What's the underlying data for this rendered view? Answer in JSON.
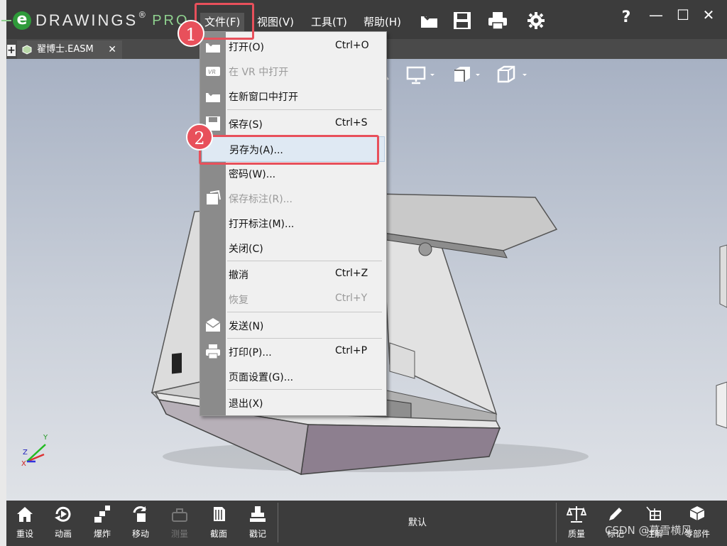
{
  "app": {
    "logo_e": "e",
    "logo_brand": "DRAWINGS",
    "logo_pro": "PRO",
    "registered_mark": "®"
  },
  "menubar": {
    "file": "文件(F)",
    "view": "视图(V)",
    "tools": "工具(T)",
    "help": "帮助(H)"
  },
  "toolbar": {
    "icons": [
      "open-icon",
      "save-icon",
      "print-icon",
      "settings-icon"
    ],
    "help_glyph": "?"
  },
  "window_controls": {
    "minimize": "—",
    "maximize": "☐",
    "close": "✕"
  },
  "tabs": {
    "add": "+",
    "document": {
      "label": "翟博士.EASM",
      "close": "✕"
    }
  },
  "file_menu": {
    "items": [
      {
        "label": "打开(O)",
        "shortcut": "Ctrl+O",
        "enabled": true,
        "icon": "open-icon"
      },
      {
        "label": "在 VR 中打开",
        "shortcut": "",
        "enabled": false,
        "icon": "vr-icon"
      },
      {
        "label": "在新窗口中打开",
        "shortcut": "",
        "enabled": true,
        "icon": "open-new-window-icon"
      },
      {
        "label": "保存(S)",
        "shortcut": "Ctrl+S",
        "enabled": true,
        "icon": "save-icon"
      },
      {
        "label": "另存为(A)...",
        "shortcut": "",
        "enabled": true,
        "icon": ""
      },
      {
        "label": "密码(W)...",
        "shortcut": "",
        "enabled": true,
        "icon": ""
      },
      {
        "label": "保存标注(R)...",
        "shortcut": "",
        "enabled": false,
        "icon": "save-markup-icon"
      },
      {
        "label": "打开标注(M)...",
        "shortcut": "",
        "enabled": true,
        "icon": ""
      },
      {
        "label": "关闭(C)",
        "shortcut": "",
        "enabled": true,
        "icon": ""
      },
      {
        "label": "撤消",
        "shortcut": "Ctrl+Z",
        "enabled": true,
        "icon": ""
      },
      {
        "label": "恢复",
        "shortcut": "Ctrl+Y",
        "enabled": false,
        "icon": ""
      },
      {
        "label": "发送(N)",
        "shortcut": "",
        "enabled": true,
        "icon": "send-icon"
      },
      {
        "label": "打印(P)...",
        "shortcut": "Ctrl+P",
        "enabled": true,
        "icon": "print-icon"
      },
      {
        "label": "页面设置(G)...",
        "shortcut": "",
        "enabled": true,
        "icon": ""
      },
      {
        "label": "退出(X)",
        "shortcut": "",
        "enabled": true,
        "icon": ""
      }
    ]
  },
  "bottom_toolbar": {
    "left": [
      {
        "label": "重设",
        "icon": "home-icon",
        "enabled": true
      },
      {
        "label": "动画",
        "icon": "animate-icon",
        "enabled": true
      },
      {
        "label": "爆炸",
        "icon": "explode-icon",
        "enabled": true
      },
      {
        "label": "移动",
        "icon": "move-icon",
        "enabled": true
      },
      {
        "label": "测量",
        "icon": "measure-icon",
        "enabled": false
      },
      {
        "label": "截面",
        "icon": "section-icon",
        "enabled": true
      },
      {
        "label": "戳记",
        "icon": "stamp-icon",
        "enabled": true
      }
    ],
    "mode": "默认",
    "right": [
      {
        "label": "质量",
        "icon": "scale-icon",
        "enabled": true
      },
      {
        "label": "标记",
        "icon": "pen-icon",
        "enabled": true
      },
      {
        "label": "注解",
        "icon": "annotation-icon",
        "enabled": true
      },
      {
        "label": "零部件",
        "icon": "component-icon",
        "enabled": true
      }
    ]
  },
  "annotations": {
    "step1": "1",
    "step2": "2"
  },
  "axis": {
    "x": "X",
    "y": "Y",
    "z": "Z"
  },
  "watermark": "CSDN @暮雪横风",
  "colors": {
    "accent_red": "#e8505b",
    "brand_green": "#2f9a3a",
    "menu_gutter": "#8b8b8b"
  }
}
